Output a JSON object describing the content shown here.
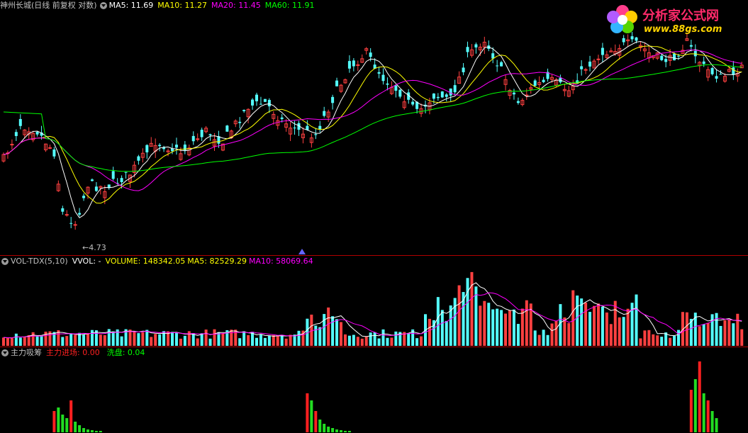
{
  "colors": {
    "up": "#ff4040",
    "down": "#54ffff",
    "ma5": "#ffffff",
    "ma10": "#ffff00",
    "ma20": "#ff00ff",
    "ma60": "#00ff00",
    "separator": "#b00000",
    "label_grey": "#c0c0c0"
  },
  "price_panel": {
    "title": "神州长城(日线 前复权 对数)",
    "ma5": "MA5: 11.69",
    "ma10": "MA10: 11.27",
    "ma20": "MA20: 11.45",
    "ma60": "MA60: 11.91",
    "low_marker": "4.73",
    "low_value": 4.73
  },
  "volume_panel": {
    "title": "VOL-TDX(5,10)",
    "vvol": "VVOL: -",
    "volume": "VOLUME: 148342.05",
    "ma5": "MA5: 82529.29",
    "ma10": "MA10: 58069.64"
  },
  "indicator_panel": {
    "title": "主力吸筹",
    "enter": "主力进场: 0.00",
    "wash": "洗盘: 0.04"
  },
  "logo": {
    "title": "分析家公式网",
    "url": "www.88gs.com"
  }
}
